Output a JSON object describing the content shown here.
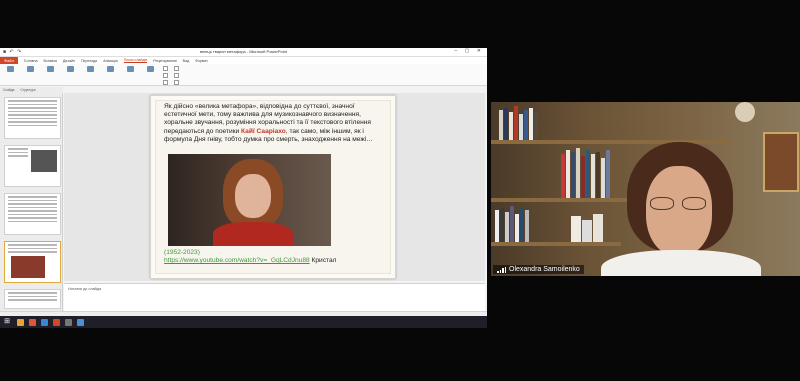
{
  "powerpoint": {
    "window_title": "вінець тварин метафора - Microsoft PowerPoint",
    "ribbon_tabs": [
      "Файл",
      "Головна",
      "Вставка",
      "Дизайн",
      "Переходи",
      "Анімація",
      "Показ слайдів",
      "Рецензування",
      "Вид",
      "Формат"
    ],
    "active_tab": "Показ слайдів",
    "panel_tabs": [
      "Слайди",
      "Структура"
    ],
    "notes_placeholder": "Нотатки до слайда",
    "slide": {
      "body_before": "Як дійсно «велика метафора», відповідна до суттєвої, значної естетичної мети, тому важлива для музикознавчого визначення, хоральне звучання, розуміння хоральності та її текстового втілення передаються до поетики ",
      "highlight": "Кайї Сааріахо",
      "body_after": ", так само, між іншим, як і формула Дня гніву, тобто думка про смерть, знаходження на межі…",
      "years": "(1952-2023)",
      "link": "https://www.youtube.com/watch?v=_GqLCdJnu88",
      "link_suffix": " Кристал"
    }
  },
  "video": {
    "participant_name": "Olexandra Samoilenko"
  },
  "colors": {
    "accent_file_tab": "#d24726",
    "slide_highlight": "#c0392b",
    "link_green": "#3b9b3b"
  }
}
